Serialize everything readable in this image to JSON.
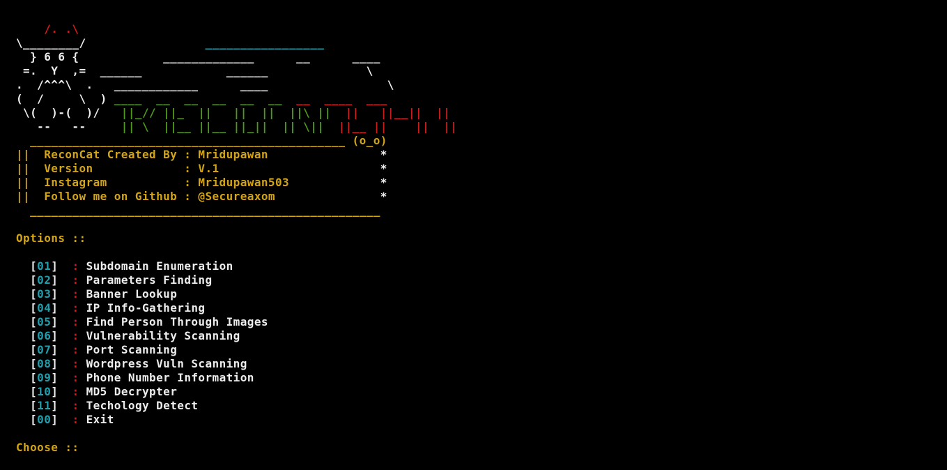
{
  "colors": {
    "background": "#000000",
    "red": "#d01b1b",
    "white": "#ededed",
    "cyan": "#1f9fae",
    "green": "#4f9a1e",
    "yellow": "#d3a416"
  },
  "banner": {
    "art": {
      "l1_cat": "    /. .\\",
      "l2_cat": "\\________/                 ",
      "l2_cyan": "_________________",
      "l3_cat": "  } 6 6 {            ",
      "l3_white": "_____________      __      ____",
      "l4_cat": " =.  Y  ,=  __",
      "l4_white": "____            ______              \\",
      "l5_cat": ".  /^^^\\  .  ",
      "l5_white": " ____________      ____                 \\",
      "l6_cat": "(  /     \\  ) ",
      "l6_green": "____  __  __  __  __  __  ",
      "l6_red": "__  ____  ___",
      "l7_cat": " \\(  )-(  )/   ",
      "l7_green": "||_// ||_  ||   ||  ||  ||\\ ||  ",
      "l7_red": "||   ||__||  ||",
      "l8_cat": "   --   --     ",
      "l8_green": "|| \\  ||__ ||__ ||_||  || \\||  ",
      "l8_red": "||__ ||    ||  ||",
      "l9_rule": "  _____________________________________________",
      "l9_face": " (o_o)"
    },
    "info": {
      "created_label": "ReconCat Created By ",
      "created_value": "Mridupawan",
      "version_label": "Version             ",
      "version_value": "V.1",
      "instagram_label": "Instagram           ",
      "instagram_value": "Mridupawan503",
      "github_label": "Follow me on Github ",
      "github_value": "@Secureaxom",
      "border_left": "||",
      "separator": ": ",
      "star": "*",
      "bottom_rule": "  __________________________________________________"
    }
  },
  "options_heading": "Options ::",
  "menu": [
    {
      "num": "01",
      "label": "Subdomain Enumeration"
    },
    {
      "num": "02",
      "label": "Parameters Finding"
    },
    {
      "num": "03",
      "label": "Banner Lookup"
    },
    {
      "num": "04",
      "label": "IP Info-Gathering"
    },
    {
      "num": "05",
      "label": "Find Person Through Images"
    },
    {
      "num": "06",
      "label": "Vulnerability Scanning"
    },
    {
      "num": "07",
      "label": "Port Scanning"
    },
    {
      "num": "08",
      "label": "Wordpress Vuln Scanning"
    },
    {
      "num": "09",
      "label": "Phone Number Information"
    },
    {
      "num": "10",
      "label": "MD5 Decrypter"
    },
    {
      "num": "11",
      "label": "Techology Detect"
    },
    {
      "num": "00",
      "label": "Exit"
    }
  ],
  "menu_sep": ":",
  "prompt": "Choose ::"
}
